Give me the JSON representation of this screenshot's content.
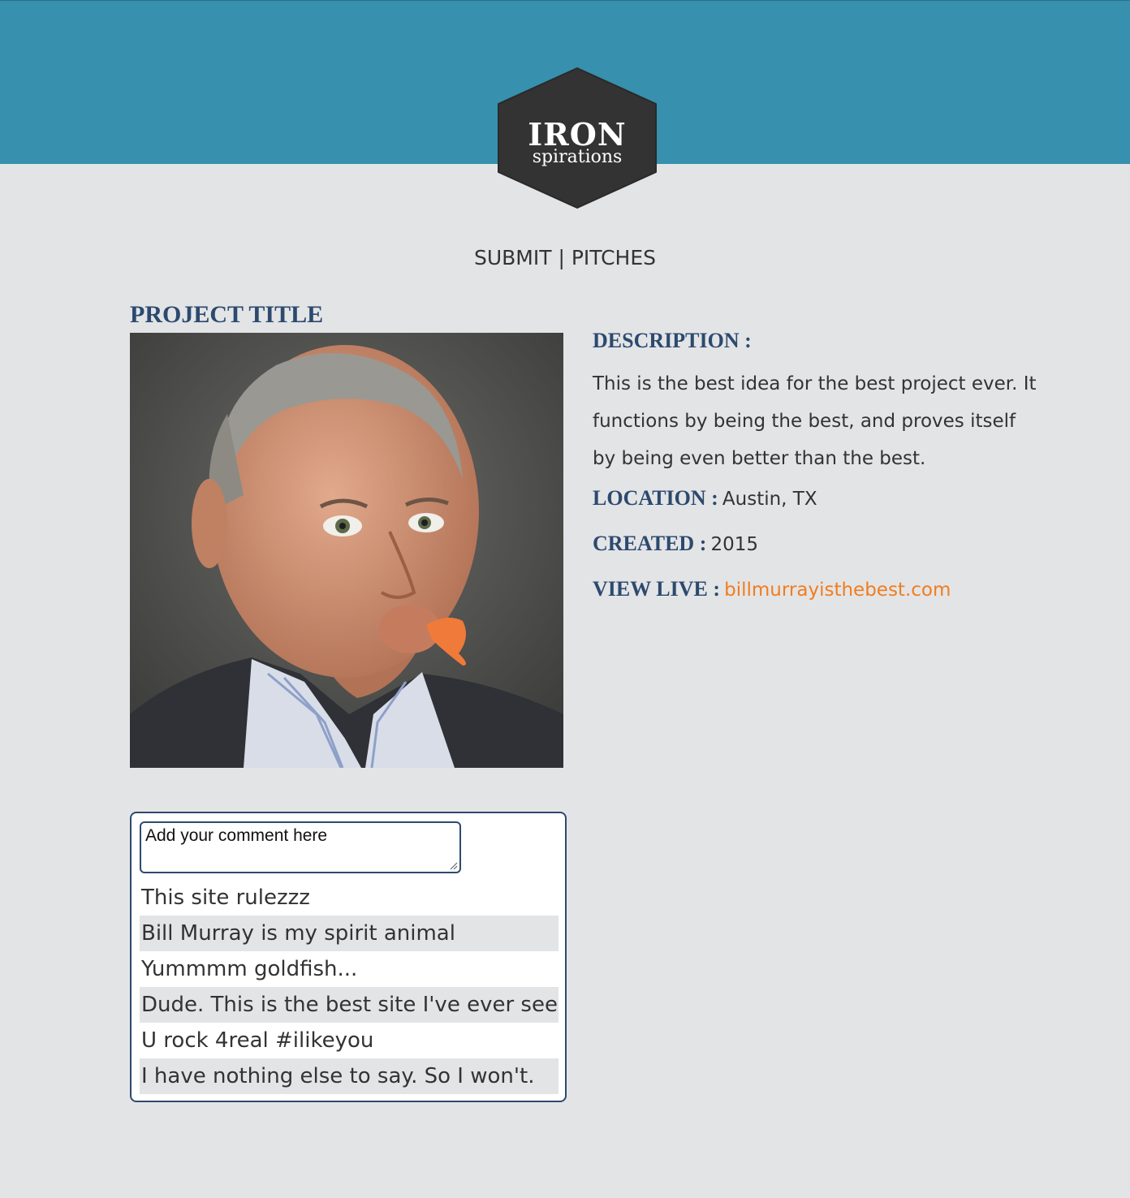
{
  "logo": {
    "line1": "IRON",
    "line2": "spirations"
  },
  "nav": {
    "submit": "SUBMIT",
    "separator": " | ",
    "pitches": "PITCHES"
  },
  "project": {
    "title": "PROJECT TITLE",
    "description_label": "DESCRIPTION :",
    "description": "This is the best idea for the best project ever. It functions by being the best, and proves itself by being even better than the best.",
    "location_label": "LOCATION :",
    "location": "Austin, TX",
    "created_label": "CREATED :",
    "created": "2015",
    "view_live_label": "VIEW LIVE :",
    "view_live_link": "billmurrayisthebest.com"
  },
  "comments": {
    "placeholder": "Add your comment here",
    "items": [
      "This site rulezzz",
      "Bill Murray is my spirit animal",
      "Yummmm goldfish...",
      "Dude. This is the best site I've ever seen.",
      "U rock 4real #ilikeyou",
      "I have nothing else to say. So I won't."
    ]
  },
  "colors": {
    "header": "#3690ae",
    "background": "#e3e4e6",
    "heading": "#2c4a6e",
    "link": "#f07d1f",
    "logo_hex": "#333333"
  }
}
